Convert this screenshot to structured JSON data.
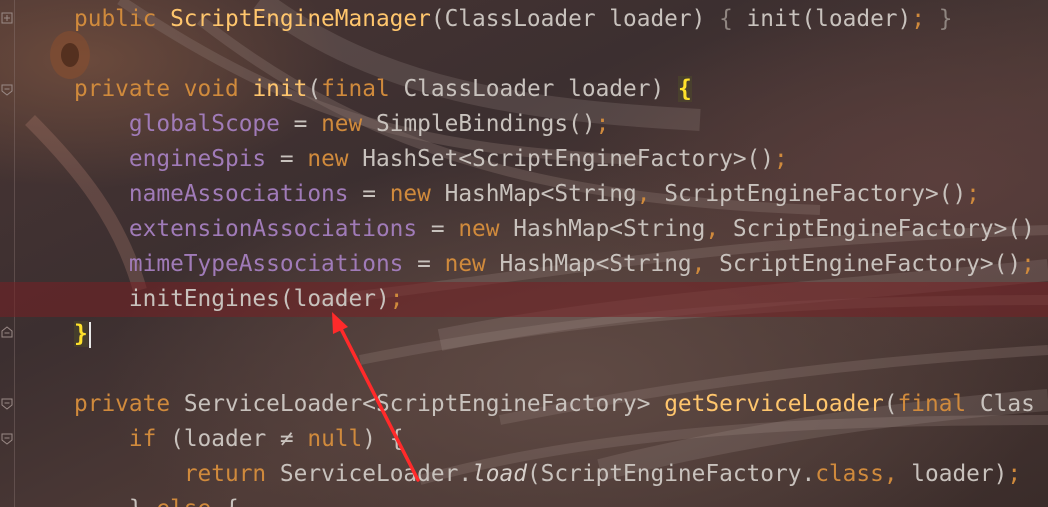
{
  "editor": {
    "language": "java",
    "lines": [
      {
        "tokens": [
          {
            "t": "public ",
            "c": "kw"
          },
          {
            "t": "ScriptEngineManager",
            "c": "fn"
          },
          {
            "t": "(ClassLoader loader) ",
            "c": "plain"
          },
          {
            "t": "{ ",
            "c": "fold-text"
          },
          {
            "t": "init(loader)",
            "c": "plain"
          },
          {
            "t": "; ",
            "c": "kw"
          },
          {
            "t": "}",
            "c": "fold-text"
          }
        ]
      },
      {
        "tokens": []
      },
      {
        "tokens": [
          {
            "t": "private void ",
            "c": "kw"
          },
          {
            "t": "init",
            "c": "fn"
          },
          {
            "t": "(",
            "c": "plain"
          },
          {
            "t": "final ",
            "c": "kw"
          },
          {
            "t": "ClassLoader loader) ",
            "c": "plain"
          },
          {
            "t": "{",
            "c": "brace-match"
          }
        ]
      },
      {
        "tokens": [
          {
            "t": "    ",
            "c": "plain"
          },
          {
            "t": "globalScope",
            "c": "fld"
          },
          {
            "t": " = ",
            "c": "plain"
          },
          {
            "t": "new ",
            "c": "kw"
          },
          {
            "t": "SimpleBindings()",
            "c": "plain"
          },
          {
            "t": ";",
            "c": "kw"
          }
        ]
      },
      {
        "tokens": [
          {
            "t": "    ",
            "c": "plain"
          },
          {
            "t": "engineSpis",
            "c": "fld"
          },
          {
            "t": " = ",
            "c": "plain"
          },
          {
            "t": "new ",
            "c": "kw"
          },
          {
            "t": "HashSet<ScriptEngineFactory>()",
            "c": "plain"
          },
          {
            "t": ";",
            "c": "kw"
          }
        ]
      },
      {
        "tokens": [
          {
            "t": "    ",
            "c": "plain"
          },
          {
            "t": "nameAssociations",
            "c": "fld"
          },
          {
            "t": " = ",
            "c": "plain"
          },
          {
            "t": "new ",
            "c": "kw"
          },
          {
            "t": "HashMap<String",
            "c": "plain"
          },
          {
            "t": ", ",
            "c": "kw"
          },
          {
            "t": "ScriptEngineFactory>()",
            "c": "plain"
          },
          {
            "t": ";",
            "c": "kw"
          }
        ]
      },
      {
        "tokens": [
          {
            "t": "    ",
            "c": "plain"
          },
          {
            "t": "extensionAssociations",
            "c": "fld"
          },
          {
            "t": " = ",
            "c": "plain"
          },
          {
            "t": "new ",
            "c": "kw"
          },
          {
            "t": "HashMap<String",
            "c": "plain"
          },
          {
            "t": ", ",
            "c": "kw"
          },
          {
            "t": "ScriptEngineFactory>()",
            "c": "plain"
          }
        ]
      },
      {
        "tokens": [
          {
            "t": "    ",
            "c": "plain"
          },
          {
            "t": "mimeTypeAssociations",
            "c": "fld"
          },
          {
            "t": " = ",
            "c": "plain"
          },
          {
            "t": "new ",
            "c": "kw"
          },
          {
            "t": "HashMap<String",
            "c": "plain"
          },
          {
            "t": ", ",
            "c": "kw"
          },
          {
            "t": "ScriptEngineFactory>()",
            "c": "plain"
          },
          {
            "t": ";",
            "c": "kw"
          }
        ]
      },
      {
        "highlight": true,
        "tokens": [
          {
            "t": "    ",
            "c": "plain"
          },
          {
            "t": "initEngines(loader)",
            "c": "plain"
          },
          {
            "t": ";",
            "c": "kw"
          }
        ]
      },
      {
        "caret": true,
        "tokens": [
          {
            "t": "}",
            "c": "brace-match"
          }
        ]
      },
      {
        "tokens": []
      },
      {
        "tokens": [
          {
            "t": "private ",
            "c": "kw"
          },
          {
            "t": "ServiceLoader<ScriptEngineFactory> ",
            "c": "plain"
          },
          {
            "t": "getServiceLoader",
            "c": "fn"
          },
          {
            "t": "(",
            "c": "plain"
          },
          {
            "t": "final ",
            "c": "kw"
          },
          {
            "t": "Clas",
            "c": "plain"
          }
        ]
      },
      {
        "tokens": [
          {
            "t": "    ",
            "c": "plain"
          },
          {
            "t": "if ",
            "c": "kw"
          },
          {
            "t": "(loader ≠ ",
            "c": "plain"
          },
          {
            "t": "null",
            "c": "kw"
          },
          {
            "t": ") {",
            "c": "plain"
          }
        ]
      },
      {
        "tokens": [
          {
            "t": "        ",
            "c": "plain"
          },
          {
            "t": "return ",
            "c": "kw"
          },
          {
            "t": "ServiceLoader.",
            "c": "plain"
          },
          {
            "t": "load",
            "c": "it"
          },
          {
            "t": "(ScriptEngineFactory.",
            "c": "plain"
          },
          {
            "t": "class",
            "c": "kw"
          },
          {
            "t": ", ",
            "c": "kw"
          },
          {
            "t": "loader)",
            "c": "plain"
          },
          {
            "t": ";",
            "c": "kw"
          }
        ]
      },
      {
        "tokens": [
          {
            "t": "    ",
            "c": "plain"
          },
          {
            "t": "} ",
            "c": "plain"
          },
          {
            "t": "else ",
            "c": "kw"
          },
          {
            "t": "{",
            "c": "plain"
          }
        ]
      }
    ]
  },
  "colors": {
    "keyword": "#d08a3c",
    "method": "#ffc66d",
    "field": "#a07bb8",
    "text": "#c8c2bd",
    "brace_match": "#ffe12b",
    "highlight_line": "#76202d",
    "arrow": "#ff2a2a"
  },
  "annotation": {
    "type": "arrow",
    "color": "#ff2a2a",
    "points_to": "initEngines(loader)"
  }
}
